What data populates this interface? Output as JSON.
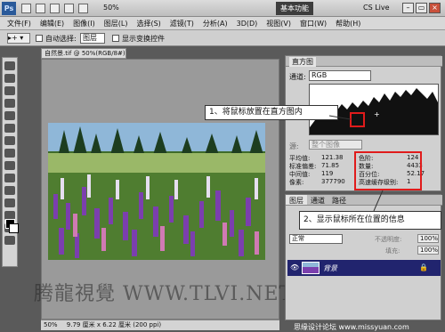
{
  "app": {
    "logo": "Ps",
    "zoom": "50%",
    "workspace_button": "基本功能",
    "cs_live": "CS Live"
  },
  "menu": [
    "文件(F)",
    "编辑(E)",
    "图像(I)",
    "图层(L)",
    "选择(S)",
    "滤镜(T)",
    "分析(A)",
    "3D(D)",
    "视图(V)",
    "窗口(W)",
    "帮助(H)"
  ],
  "options_bar": {
    "auto_select_label": "自动选择:",
    "auto_select_value": "图层",
    "show_transform_label": "显示变换控件"
  },
  "document": {
    "tab_title": "自然景.tif @ 50%(RGB/8#)",
    "status_zoom": "50%",
    "status_size": "9.79 厘米 x 6.22 厘米 (200 ppi)"
  },
  "histogram_panel": {
    "tab": "直方图",
    "channel_label": "通道:",
    "channel_value": "RGB",
    "source_label": "源:",
    "source_value": "整个图像",
    "stats_left": [
      {
        "label": "平均值:",
        "value": "121.38"
      },
      {
        "label": "标准偏差:",
        "value": "71.85"
      },
      {
        "label": "中间值:",
        "value": "119"
      },
      {
        "label": "像素:",
        "value": "377790"
      }
    ],
    "stats_right": [
      {
        "label": "色阶:",
        "value": "124"
      },
      {
        "label": "数量:",
        "value": "4433"
      },
      {
        "label": "百分位:",
        "value": "52.17"
      },
      {
        "label": "高速缓存级别:",
        "value": "1"
      }
    ]
  },
  "layers_panel": {
    "tabs": [
      "图层",
      "通道",
      "路径"
    ],
    "blend_mode": "正常",
    "opacity_label": "不透明度:",
    "opacity_value": "100%",
    "fill_label": "填充:",
    "fill_value": "100%",
    "layer_name": "背景"
  },
  "annotations": {
    "callout1": "1、将鼠标放置在直方图内",
    "callout2": "2、显示鼠标所在位置的信息"
  },
  "watermark": "腾龍視覺 WWW.TLVI.NET",
  "footer": "思缘设计论坛 www.missyuan.com",
  "colors": {
    "accent_red": "#e01b1b",
    "layer_selected": "#21246e"
  }
}
